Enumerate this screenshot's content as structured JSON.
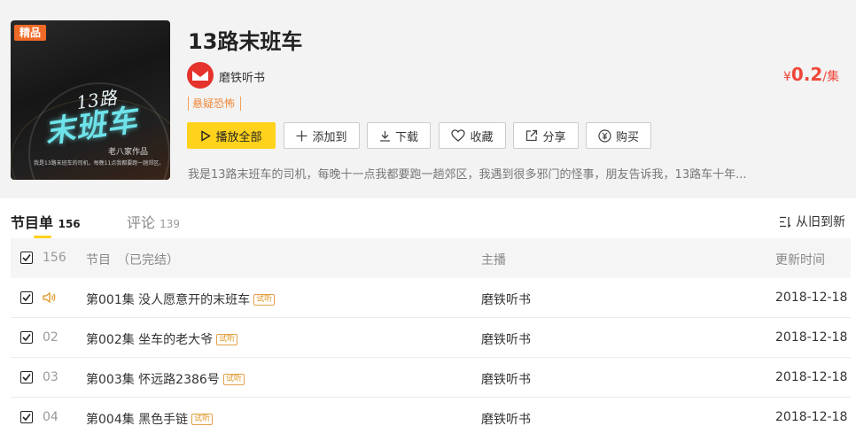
{
  "album": {
    "badge": "精品",
    "cover_title": "末班车",
    "cover_title_num": "13路",
    "cover_author": "老八家作品",
    "cover_caption": "我是13路末班车的司机，每晚11点我都要跑一趟郊区。",
    "title": "13路末班车",
    "anchor": "磨铁听书",
    "price_symbol": "¥",
    "price_value": "0.2",
    "price_unit": "/集",
    "tag": "悬疑恐怖",
    "description": "我是13路末班车的司机，每晚十一点我都要跑一趟郊区，我遇到很多邪门的怪事，朋友告诉我，13路车十年..."
  },
  "actions": {
    "play_all": "播放全部",
    "add_to": "添加到",
    "download": "下载",
    "favorite": "收藏",
    "share": "分享",
    "buy": "购买"
  },
  "tabs": {
    "programs_label": "节目单",
    "programs_count": "156",
    "comments_label": "评论",
    "comments_count": "139",
    "sort_label": "从旧到新"
  },
  "table": {
    "header": {
      "count": "156",
      "title": "节目　（已完结）",
      "anchor": "主播",
      "date": "更新时间"
    },
    "rows": [
      {
        "idx": "",
        "title": "第001集 没人愿意开的末班车",
        "badge": "试听",
        "anchor": "磨铁听书",
        "date": "2018-12-18",
        "playing": true
      },
      {
        "idx": "02",
        "title": "第002集 坐车的老大爷",
        "badge": "试听",
        "anchor": "磨铁听书",
        "date": "2018-12-18",
        "playing": false
      },
      {
        "idx": "03",
        "title": "第003集 怀远路2386号",
        "badge": "试听",
        "anchor": "磨铁听书",
        "date": "2018-12-18",
        "playing": false
      },
      {
        "idx": "04",
        "title": "第004集 黑色手链",
        "badge": "试听",
        "anchor": "磨铁听书",
        "date": "2018-12-18",
        "playing": false
      }
    ]
  },
  "colors": {
    "accent_yellow": "#ffd21c",
    "price_red": "#f0473a",
    "tag_orange": "#f0883a",
    "badge_orange": "#f06a27"
  }
}
